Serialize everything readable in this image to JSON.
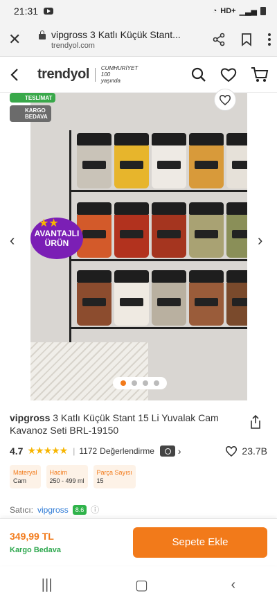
{
  "status_bar": {
    "time": "21:31",
    "network": "HD+"
  },
  "browser": {
    "page_title": "vipgross 3 Katlı Küçük Stant...",
    "domain": "trendyol.com"
  },
  "site_header": {
    "brand": "trendyol",
    "centennial": "CUMHURİYET 100 yaşında"
  },
  "gallery": {
    "badge_delivery": "TESLİMAT",
    "badge_shipping_line1": "KARGO",
    "badge_shipping_line2": "BEDAVA",
    "advantage_line1": "AVANTAJLI",
    "advantage_line2": "ÜRÜN",
    "slide_count": 4,
    "active_slide": 1
  },
  "product": {
    "brand": "vipgross",
    "title": "3 Katlı Küçük Stant 15 Li Yuvalak Cam Kavanoz Seti BRL-19150",
    "rating": "4.7",
    "review_count": "1172",
    "review_label": "Değerlendirme",
    "favorites": "23.7B",
    "specs": [
      {
        "key": "Materyal",
        "value": "Cam"
      },
      {
        "key": "Hacim",
        "value": "250 - 499 ml"
      },
      {
        "key": "Parça Sayısı",
        "value": "15"
      }
    ],
    "seller_label": "Satıcı:",
    "seller_name": "vipgross",
    "seller_score": "8.6"
  },
  "checkout": {
    "price": "349,99 TL",
    "shipping": "Kargo Bedava",
    "cta": "Sepete Ekle"
  },
  "colors": {
    "accent": "#f27a1a",
    "advantage_badge": "#7b1fb5",
    "delivery_badge": "#39a84a"
  }
}
